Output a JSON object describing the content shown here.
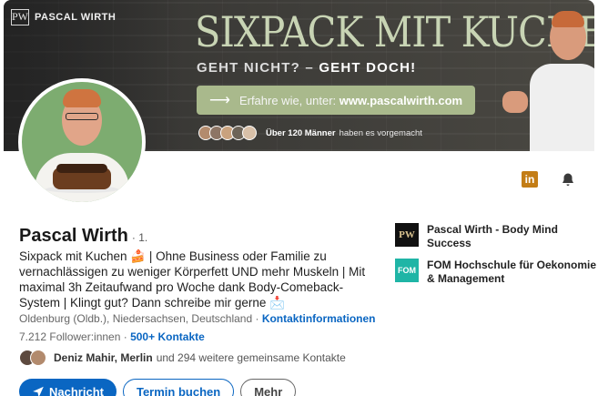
{
  "banner": {
    "brand_logo": "PW",
    "brand_name": "PASCAL WIRTH",
    "headline": "SIXPACK MIT KUCHEN?",
    "sub_part1": "GEHT NICHT? – ",
    "sub_part2": "GEHT DOCH!",
    "cta_prefix": "Erfahre wie, unter: ",
    "cta_url": "www.pascalwirth.com",
    "social_bold": "Über 120 Männer",
    "social_rest": " haben es vorgemacht"
  },
  "profile": {
    "name": "Pascal Wirth",
    "degree": "· 1.",
    "headline": "Sixpack mit Kuchen 🍰 | Ohne Business oder Familie zu vernachlässigen zu weniger Körperfett UND mehr Muskeln | Mit maximal 3h Zeitaufwand pro Woche dank Body-Comeback-System | Klingt gut? Dann schreibe mir gerne 📩",
    "location": "Oldenburg (Oldb.), Niedersachsen, Deutschland",
    "separator": " · ",
    "contact_info": "Kontaktinformationen",
    "followers": "7.212 Follower:innen",
    "followers_sep": " · ",
    "connections": "500+ Kontakte",
    "mutual_names": "Deniz Mahir, Merlin",
    "mutual_rest": " und 294 weitere gemeinsame Kontakte"
  },
  "icons": {
    "linkedin": "in",
    "bell": "bell-icon"
  },
  "buttons": {
    "primary": "Nachricht",
    "secondary": "Termin buchen",
    "tertiary": "Mehr"
  },
  "experience": [
    {
      "logo": "PW",
      "title": "Pascal Wirth - Body Mind Success"
    },
    {
      "logo": "FOM",
      "title": "FOM Hochschule für Oekonomie & Management"
    }
  ],
  "colors": {
    "link": "#0a66c2",
    "banner_accent": "#a9b98c",
    "avatar_bg": "#7dac70",
    "linkedin_icon": "#c37d16"
  }
}
